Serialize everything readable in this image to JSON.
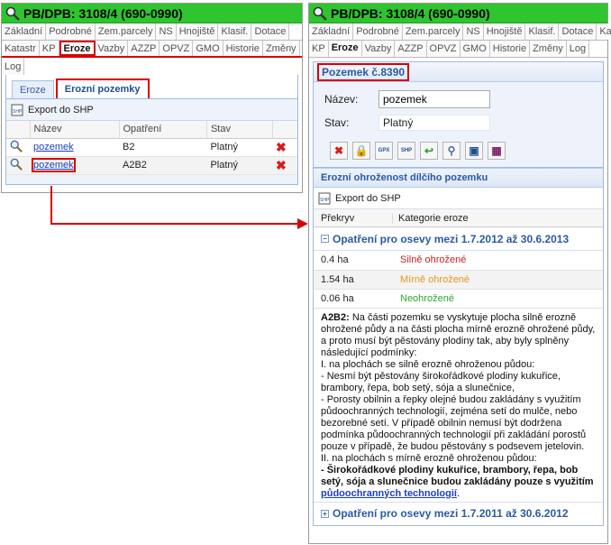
{
  "window_title": "PB/DPB: 3108/4 (690-0990)",
  "tabs_row1": [
    "Základní",
    "Podrobné",
    "Zem.parcely",
    "NS",
    "Hnojiště",
    "Klasif.",
    "Dotace"
  ],
  "tabs_row2": [
    "Katastr",
    "KP",
    "Eroze",
    "Vazby",
    "AZZP",
    "OPVZ",
    "GMO",
    "Historie",
    "Změny"
  ],
  "tabs_row3": [
    "Log"
  ],
  "right_tabs_row1": [
    "Základní",
    "Podrobné",
    "Zem.parcely",
    "NS",
    "Hnojiště",
    "Klasif.",
    "Dotace",
    "Kat"
  ],
  "right_tabs_row2": [
    "KP",
    "Eroze",
    "Vazby",
    "AZZP",
    "OPVZ",
    "GMO",
    "Historie",
    "Změny",
    "Log"
  ],
  "subtabs": [
    "Eroze",
    "Erozní pozemky"
  ],
  "export_label": "Export do SHP",
  "left_table": {
    "headers": [
      "Název",
      "Opatření",
      "Stav"
    ],
    "rows": [
      {
        "name": "pozemek",
        "measure": "B2",
        "status": "Platný"
      },
      {
        "name": "pozemek",
        "measure": "A2B2",
        "status": "Platný"
      }
    ]
  },
  "detail": {
    "title": "Pozemek č.8390",
    "name_label": "Název:",
    "name_value": "pozemek",
    "state_label": "Stav:",
    "state_value": "Platný"
  },
  "erosion": {
    "section_title": "Erozní ohroženost dílčího pozemku",
    "headers": [
      "Překryv",
      "Kategorie eroze"
    ],
    "group1_title": "Opatření pro osevy mezi 1.7.2012 až 30.6.2013",
    "rows": [
      {
        "area": "0.4 ha",
        "category": "Silně ohrožené"
      },
      {
        "area": "1.54 ha",
        "category": "Mírně ohrožené"
      },
      {
        "area": "0.06 ha",
        "category": "Neohrožené"
      }
    ],
    "note": {
      "code": "A2B2:",
      "intro": " Na části pozemku se vyskytuje plocha silně erozně ohrožené půdy a na části plocha mírně erozně ohrožené půdy, a proto musí být pěstovány plodiny tak, aby byly splněny následující podmínky:",
      "l1": "I. na plochách se silně erozně ohroženou půdou:",
      "l2": "- Nesmí být pěstovány širokořádkové plodiny kukuřice, brambory, řepa, bob setý, sója a slunečnice,",
      "l3": "- Porosty obilnin a řepky olejné budou zakládány s využitím půdoochranných technologií, zejména setí do mulče, nebo bezorebné setí. V případě obilnin nemusí být dodržena podmínka půdoochranných technologií při zakládání porostů pouze v případě, že budou pěstovány s podsevem jetelovin.",
      "l4": "II. na plochách s mírně erozně ohroženou půdou:",
      "l5_bold": "- Širokořádkové plodiny kukuřice, brambory, řepa, bob setý, sója a slunečnice budou zakládány pouze s využitím ",
      "l5_link": "půdoochranných technologií",
      "l5_end": "."
    },
    "group2_title": "Opatření pro osevy mezi 1.7.2011 až 30.6.2012"
  },
  "colors": {
    "title_green": "#2ec52e",
    "highlight_red": "#d80000",
    "strong": "#d02020",
    "moderate": "#e8941e",
    "none": "#2ea52e"
  }
}
